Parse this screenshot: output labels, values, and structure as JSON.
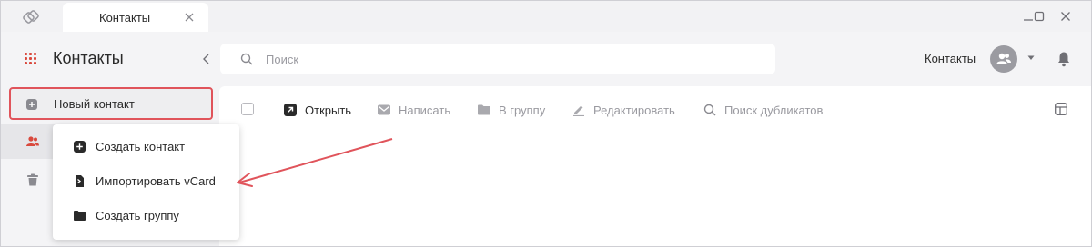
{
  "window": {
    "tab_title": "Контакты"
  },
  "header": {
    "app_title": "Контакты",
    "search_placeholder": "Поиск",
    "contacts_label": "Контакты"
  },
  "sidebar": {
    "new_contact_label": "Новый контакт"
  },
  "toolbar": {
    "items": [
      {
        "label": "Открыть",
        "icon": "open-external-icon",
        "enabled": true
      },
      {
        "label": "Написать",
        "icon": "envelope-icon",
        "enabled": false
      },
      {
        "label": "В группу",
        "icon": "folder-icon",
        "enabled": false
      },
      {
        "label": "Редактировать",
        "icon": "pencil-icon",
        "enabled": false
      },
      {
        "label": "Поиск дубликатов",
        "icon": "search-icon",
        "enabled": false
      }
    ]
  },
  "menu": {
    "items": [
      {
        "label": "Создать контакт",
        "icon": "plus-square-icon"
      },
      {
        "label": "Импортировать vCard",
        "icon": "import-file-icon"
      },
      {
        "label": "Создать группу",
        "icon": "folder-icon"
      }
    ]
  },
  "colors": {
    "accent": "#d9493d",
    "highlight_border": "#e0545b",
    "annotation_arrow": "#e0545b"
  }
}
